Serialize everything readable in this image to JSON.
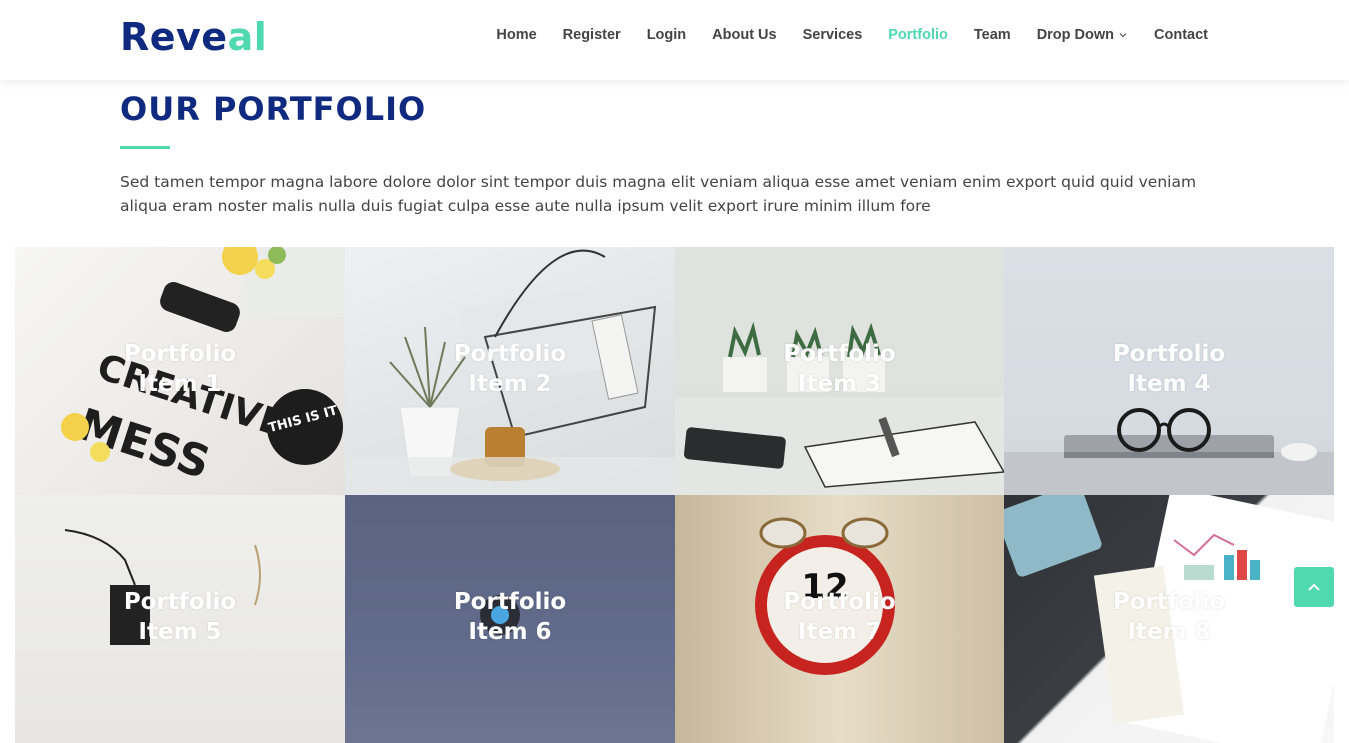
{
  "logo": {
    "part1": "Reve",
    "part2": "al"
  },
  "nav": {
    "items": [
      {
        "label": "Home"
      },
      {
        "label": "Register"
      },
      {
        "label": "Login"
      },
      {
        "label": "About Us"
      },
      {
        "label": "Services"
      },
      {
        "label": "Portfolio",
        "active": true
      },
      {
        "label": "Team"
      },
      {
        "label": "Drop Down",
        "dropdown": true
      },
      {
        "label": "Contact"
      }
    ]
  },
  "section": {
    "title": "OUR PORTFOLIO",
    "description": "Sed tamen tempor magna labore dolore dolor sint tempor duis magna elit veniam aliqua esse amet veniam enim export quid quid veniam aliqua eram noster malis nulla duis fugiat culpa esse aute nulla ipsum velit export irure minim illum fore"
  },
  "portfolio": {
    "items": [
      {
        "line1": "Portfolio",
        "line2": "Item 1"
      },
      {
        "line1": "Portfolio",
        "line2": "Item 2"
      },
      {
        "line1": "Portfolio",
        "line2": "Item 3"
      },
      {
        "line1": "Portfolio",
        "line2": "Item 4"
      },
      {
        "line1": "Portfolio",
        "line2": "Item 5"
      },
      {
        "line1": "Portfolio",
        "line2": "Item 6"
      },
      {
        "line1": "Portfolio",
        "line2": "Item 7"
      },
      {
        "line1": "Portfolio",
        "line2": "Item 8"
      }
    ]
  },
  "tile_decor": {
    "t1_text1": "CREATIVE",
    "t1_text2": "MESS",
    "t1_badge": "THIS IS IT",
    "t7_clock": "12"
  },
  "colors": {
    "brand": "#0f2a7f",
    "accent": "#50d8af"
  },
  "icons": {
    "back_to_top": "chevron-up-icon",
    "dropdown": "chevron-down-icon"
  }
}
